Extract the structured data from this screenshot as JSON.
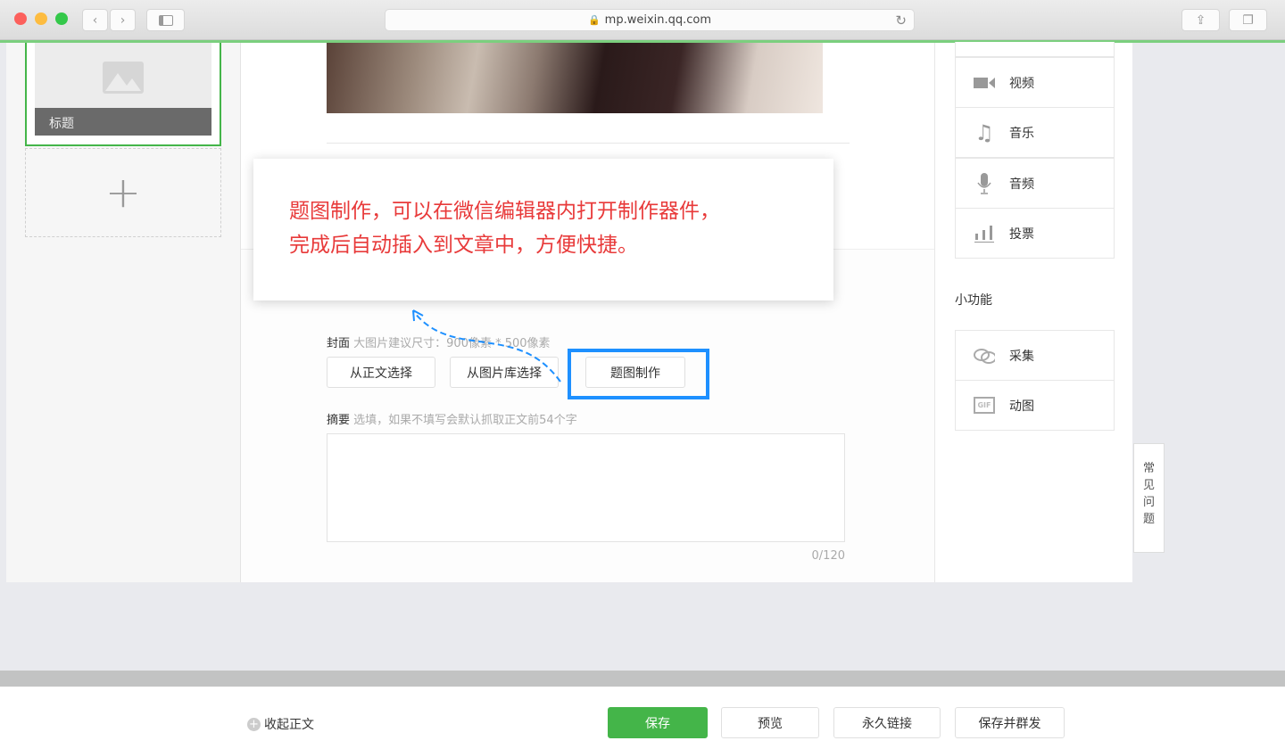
{
  "browser": {
    "url": "mp.weixin.qq.com"
  },
  "left": {
    "article_title": "标题"
  },
  "tooltip": {
    "line1": "题图制作，可以在微信编辑器内打开制作器件，",
    "line2": "完成后自动插入到文章中，方便快捷。"
  },
  "cover": {
    "label": "封面",
    "hint": "大图片建议尺寸：900像素 * 500像素",
    "buttons": [
      "从正文选择",
      "从图片库选择",
      "题图制作"
    ]
  },
  "summary": {
    "label": "摘要",
    "hint": "选填，如果不填写会默认抓取正文前54个字",
    "counter": "0/120",
    "value": ""
  },
  "right": {
    "media": [
      {
        "label": "视频",
        "icon": "video-icon"
      },
      {
        "label": "音乐",
        "icon": "music-icon"
      },
      {
        "label": "音频",
        "icon": "microphone-icon"
      },
      {
        "label": "投票",
        "icon": "vote-chart-icon"
      }
    ],
    "section": "小功能",
    "tools": [
      {
        "label": "采集",
        "icon": "link-icon"
      },
      {
        "label": "动图",
        "icon": "gif-icon"
      }
    ]
  },
  "faq": {
    "label": "常见问题"
  },
  "footer": {
    "collapse": "收起正文",
    "save": "保存",
    "preview": "预览",
    "permalink": "永久链接",
    "save_send": "保存并群发"
  },
  "colors": {
    "accent": "#44b549",
    "highlight": "#1e90ff",
    "tooltip_text": "#e83a3a"
  }
}
